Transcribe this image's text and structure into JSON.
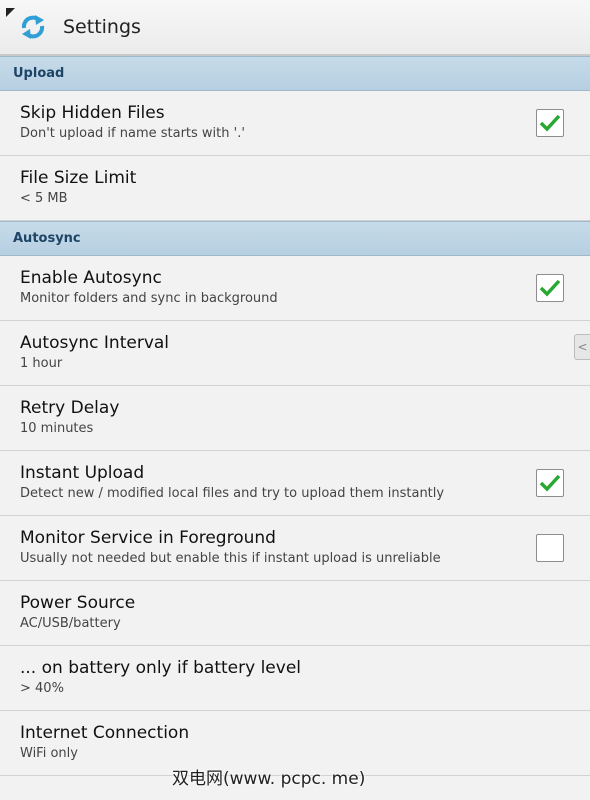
{
  "app": {
    "title": "Settings",
    "icon": "sync-arrows-icon"
  },
  "sections": {
    "upload": {
      "label": "Upload",
      "skip_hidden": {
        "title": "Skip Hidden Files",
        "summary": "Don't upload if name starts with '.'",
        "checked": true
      },
      "file_size": {
        "title": "File Size Limit",
        "summary": "< 5 MB"
      }
    },
    "autosync": {
      "label": "Autosync",
      "enable": {
        "title": "Enable Autosync",
        "summary": "Monitor folders and sync in background",
        "checked": true
      },
      "interval": {
        "title": "Autosync Interval",
        "summary": "1 hour"
      },
      "retry": {
        "title": "Retry Delay",
        "summary": "10 minutes"
      },
      "instant": {
        "title": "Instant Upload",
        "summary": "Detect new / modified local files and try to upload them instantly",
        "checked": true
      },
      "monitor": {
        "title": "Monitor Service in Foreground",
        "summary": "Usually not needed but enable this if instant upload is unreliable",
        "checked": false
      },
      "power": {
        "title": "Power Source",
        "summary": "AC/USB/battery"
      },
      "battery": {
        "title": "... on battery only if battery level",
        "summary": "> 40%"
      },
      "internet": {
        "title": "Internet Connection",
        "summary": "WiFi only"
      }
    }
  },
  "side_handle": "<",
  "watermark": "双电网(www. pcpc. me)",
  "colors": {
    "section_bg": "#bcd3e5",
    "section_text": "#1e4466",
    "check_green": "#27a832",
    "icon_blue": "#2f9fd6"
  }
}
